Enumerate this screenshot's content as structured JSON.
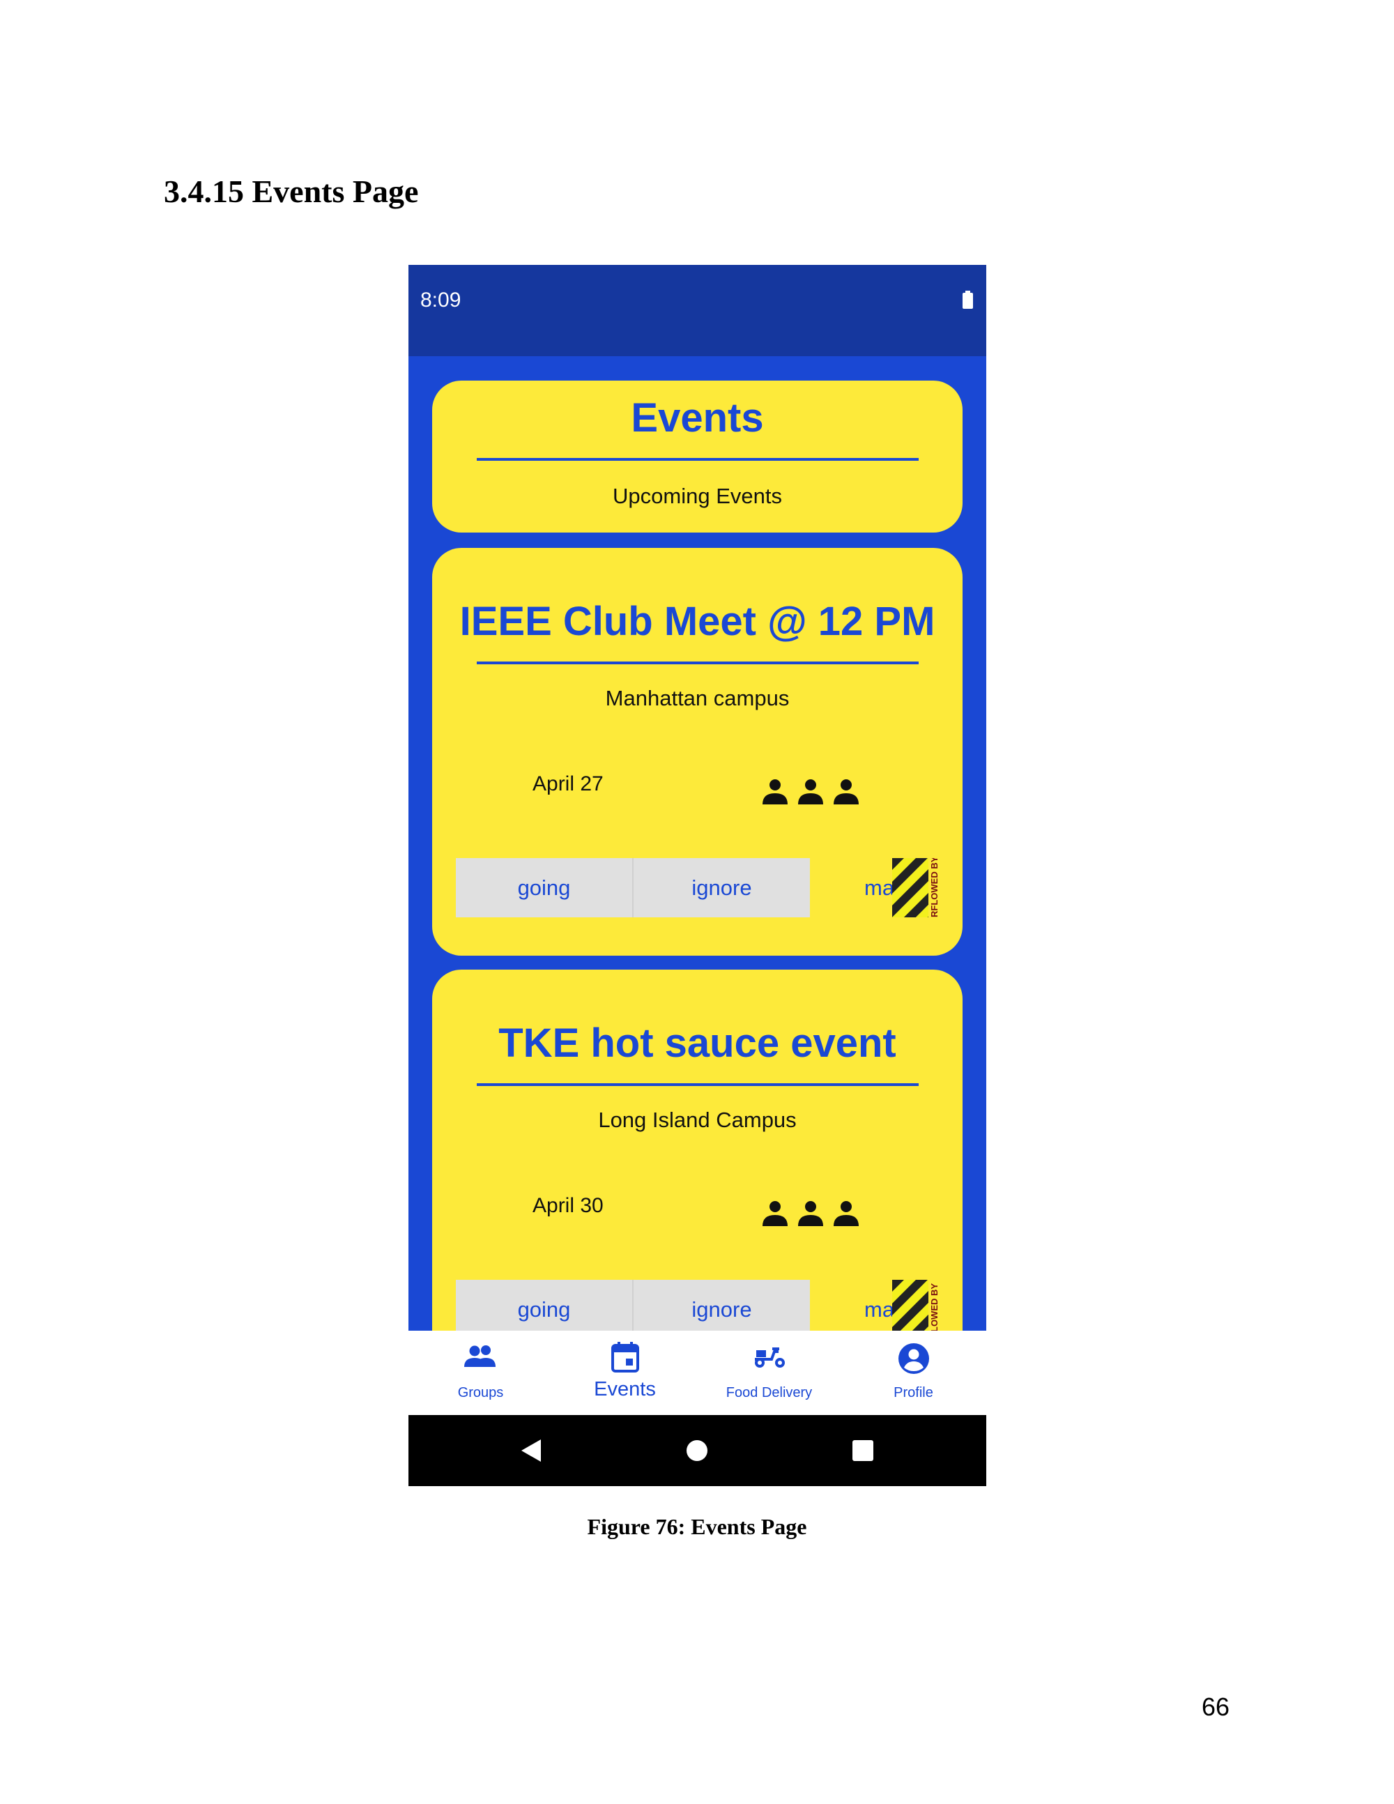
{
  "document": {
    "section_heading": "3.4.15 Events Page",
    "caption": "Figure 76: Events Page",
    "page_number": "66"
  },
  "status_bar": {
    "time": "8:09",
    "battery_icon": "battery-full-icon"
  },
  "header": {
    "title": "Events",
    "subtitle": "Upcoming Events"
  },
  "events": [
    {
      "title": "IEEE Club Meet @ 12 PM",
      "location": "Manhattan campus",
      "date": "April 27",
      "attendees_icon": "people-icon",
      "buttons": {
        "going": "going",
        "ignore": "ignore",
        "maybe": "ma"
      },
      "overflow_label": "RFLOWED BY"
    },
    {
      "title": "TKE hot sauce event",
      "location": "Long Island Campus",
      "date": "April 30",
      "attendees_icon": "people-icon",
      "buttons": {
        "going": "going",
        "ignore": "ignore",
        "maybe": "ma"
      },
      "overflow_label": "LOWED BY"
    }
  ],
  "bottom_nav": {
    "items": [
      {
        "label": "Groups",
        "icon": "group-icon",
        "active": false
      },
      {
        "label": "Events",
        "icon": "calendar-icon",
        "active": true
      },
      {
        "label": "Food Delivery",
        "icon": "scooter-icon",
        "active": false
      },
      {
        "label": "Profile",
        "icon": "account-circle-icon",
        "active": false
      }
    ]
  },
  "system_nav": {
    "back_icon": "back-triangle-icon",
    "home_icon": "home-circle-icon",
    "recents_icon": "recents-square-icon"
  },
  "colors": {
    "primary_blue": "#1a48d4",
    "status_bar_blue": "#15379e",
    "card_yellow": "#fdea3a",
    "button_gray": "#e0e0e0"
  }
}
